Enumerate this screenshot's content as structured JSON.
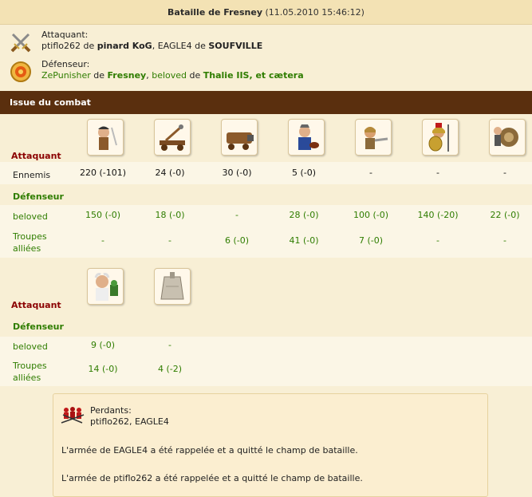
{
  "title": {
    "main": "Bataille de Fresney",
    "timestamp": "(11.05.2010 15:46:12)"
  },
  "attacker": {
    "label": "Attaquant:",
    "player": "ptiflo262",
    "de1": "de",
    "city": "pinard KoG",
    "sep": ",",
    "player2": "EAGLE4",
    "de2": "de",
    "city2": "SOUFVILLE"
  },
  "defender": {
    "label": "Défenseur:",
    "player": "ZePunisher",
    "de1": "de",
    "city": "Fresney",
    "sep": ",",
    "player2": "beloved",
    "de2": "de",
    "city2": "Thalie IIS, et cætera"
  },
  "section_title": "Issue du combat",
  "land": {
    "attacker_label": "Attaquant",
    "enemies_label": "Ennemis",
    "enemies_values": [
      "220 (-101)",
      "24 (-0)",
      "30 (-0)",
      "5 (-0)",
      "-",
      "-",
      "-"
    ],
    "defender_label": "Défenseur",
    "beloved_label": "beloved",
    "beloved_values": [
      "150 (-0)",
      "18 (-0)",
      "-",
      "28 (-0)",
      "100 (-0)",
      "140 (-20)",
      "22 (-0)"
    ],
    "allied_label_1": "Troupes",
    "allied_label_2": "alliées",
    "allied_values": [
      "-",
      "-",
      "6 (-0)",
      "41 (-0)",
      "7 (-0)",
      "-",
      "-"
    ],
    "units": [
      "swordsman-icon",
      "catapult-icon",
      "battering-ram-icon",
      "slinger-icon",
      "hoplite-icon",
      "spartan-icon",
      "ballista-icon"
    ]
  },
  "sea": {
    "attacker_label": "Attaquant",
    "defender_label": "Défenseur",
    "beloved_label": "beloved",
    "beloved_values": [
      "9 (-0)",
      "-"
    ],
    "allied_label_1": "Troupes",
    "allied_label_2": "alliées",
    "allied_values": [
      "14 (-0)",
      "4 (-2)"
    ],
    "units": [
      "doctor-icon",
      "wall-icon"
    ]
  },
  "losers": {
    "label": "Perdants:",
    "names": "ptiflo262, EAGLE4",
    "msg1": "L'armée de EAGLE4 a été rappelée et a quitté le champ de bataille.",
    "msg2": "L'armée de ptiflo262 a été rappelée et a quitté le champ de bataille."
  },
  "colors": {
    "attacker": "#8b0000",
    "defender": "#2f7d00",
    "header_bg": "#5a2f0e"
  }
}
